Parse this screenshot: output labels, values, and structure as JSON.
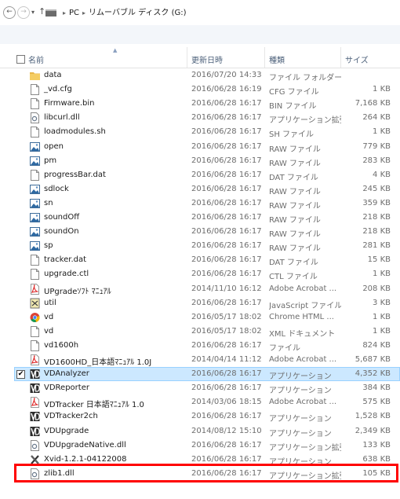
{
  "address": {
    "back_glyph": "←",
    "forward_glyph": "→",
    "dropdown_glyph": "▾",
    "up_glyph": "↑",
    "crumbs": [
      "PC",
      "リムーバブル ディスク (G:)"
    ]
  },
  "header": {
    "name": "名前",
    "date": "更新日時",
    "type": "種類",
    "size": "サイズ"
  },
  "files": [
    {
      "name": "data",
      "date": "2016/07/20 14:33",
      "type": "ファイル フォルダー",
      "size": "",
      "icon": "folder"
    },
    {
      "name": "_vd.cfg",
      "date": "2016/06/28 16:19",
      "type": "CFG ファイル",
      "size": "1 KB",
      "icon": "file"
    },
    {
      "name": "Firmware.bin",
      "date": "2016/06/28 16:17",
      "type": "BIN ファイル",
      "size": "7,168 KB",
      "icon": "file"
    },
    {
      "name": "libcurl.dll",
      "date": "2016/06/28 16:17",
      "type": "アプリケーション拡張",
      "size": "264 KB",
      "icon": "dll"
    },
    {
      "name": "loadmodules.sh",
      "date": "2016/06/28 16:17",
      "type": "SH ファイル",
      "size": "1 KB",
      "icon": "file"
    },
    {
      "name": "open",
      "date": "2016/06/28 16:17",
      "type": "RAW ファイル",
      "size": "779 KB",
      "icon": "image"
    },
    {
      "name": "pm",
      "date": "2016/06/28 16:17",
      "type": "RAW ファイル",
      "size": "283 KB",
      "icon": "image"
    },
    {
      "name": "progressBar.dat",
      "date": "2016/06/28 16:17",
      "type": "DAT ファイル",
      "size": "4 KB",
      "icon": "file"
    },
    {
      "name": "sdlock",
      "date": "2016/06/28 16:17",
      "type": "RAW ファイル",
      "size": "245 KB",
      "icon": "image"
    },
    {
      "name": "sn",
      "date": "2016/06/28 16:17",
      "type": "RAW ファイル",
      "size": "359 KB",
      "icon": "image"
    },
    {
      "name": "soundOff",
      "date": "2016/06/28 16:17",
      "type": "RAW ファイル",
      "size": "218 KB",
      "icon": "image"
    },
    {
      "name": "soundOn",
      "date": "2016/06/28 16:17",
      "type": "RAW ファイル",
      "size": "218 KB",
      "icon": "image"
    },
    {
      "name": "sp",
      "date": "2016/06/28 16:17",
      "type": "RAW ファイル",
      "size": "281 KB",
      "icon": "image"
    },
    {
      "name": "tracker.dat",
      "date": "2016/06/28 16:17",
      "type": "DAT ファイル",
      "size": "15 KB",
      "icon": "file"
    },
    {
      "name": "upgrade.ctl",
      "date": "2016/06/28 16:17",
      "type": "CTL ファイル",
      "size": "1 KB",
      "icon": "file"
    },
    {
      "name": "UPgradeｿﾌﾄ ﾏﾆｭｱﾙ",
      "date": "2014/11/10 16:12",
      "type": "Adobe Acrobat ...",
      "size": "208 KB",
      "icon": "pdf"
    },
    {
      "name": "util",
      "date": "2016/06/28 16:17",
      "type": "JavaScript ファイル",
      "size": "3 KB",
      "icon": "js"
    },
    {
      "name": "vd",
      "date": "2016/05/17 18:02",
      "type": "Chrome HTML ...",
      "size": "1 KB",
      "icon": "chrome"
    },
    {
      "name": "vd",
      "date": "2016/05/17 18:02",
      "type": "XML ドキュメント",
      "size": "1 KB",
      "icon": "file"
    },
    {
      "name": "vd1600h",
      "date": "2016/06/28 16:17",
      "type": "ファイル",
      "size": "824 KB",
      "icon": "file"
    },
    {
      "name": "VD1600HD_日本語ﾏﾆｭｱﾙ 1.0J",
      "date": "2014/04/14 11:12",
      "type": "Adobe Acrobat ...",
      "size": "5,687 KB",
      "icon": "pdf"
    },
    {
      "name": "VDAnalyzer",
      "date": "2016/06/28 16:17",
      "type": "アプリケーション",
      "size": "4,352 KB",
      "icon": "app",
      "selected": true
    },
    {
      "name": "VDReporter",
      "date": "2016/06/28 16:17",
      "type": "アプリケーション",
      "size": "384 KB",
      "icon": "app"
    },
    {
      "name": "VDTracker 日本語ﾏﾆｭｱﾙ 1.0",
      "date": "2014/03/06 18:15",
      "type": "Adobe Acrobat ...",
      "size": "575 KB",
      "icon": "pdf"
    },
    {
      "name": "VDTracker2ch",
      "date": "2016/06/28 16:17",
      "type": "アプリケーション",
      "size": "1,528 KB",
      "icon": "app"
    },
    {
      "name": "VDUpgrade",
      "date": "2014/08/12 15:10",
      "type": "アプリケーション",
      "size": "2,349 KB",
      "icon": "app"
    },
    {
      "name": "VDUpgradeNative.dll",
      "date": "2016/06/28 16:17",
      "type": "アプリケーション拡張",
      "size": "133 KB",
      "icon": "dll"
    },
    {
      "name": "Xvid-1.2.1-04122008",
      "date": "2016/06/28 16:17",
      "type": "アプリケーション",
      "size": "638 KB",
      "icon": "xvid",
      "highlighted": true
    },
    {
      "name": "zlib1.dll",
      "date": "2016/06/28 16:17",
      "type": "アプリケーション拡張",
      "size": "105 KB",
      "icon": "dll"
    }
  ],
  "colors": {
    "selection_bg": "#cce8ff",
    "selection_border": "#99d1ff",
    "highlight_box": "#ff0000",
    "header_text": "#4c607a"
  }
}
